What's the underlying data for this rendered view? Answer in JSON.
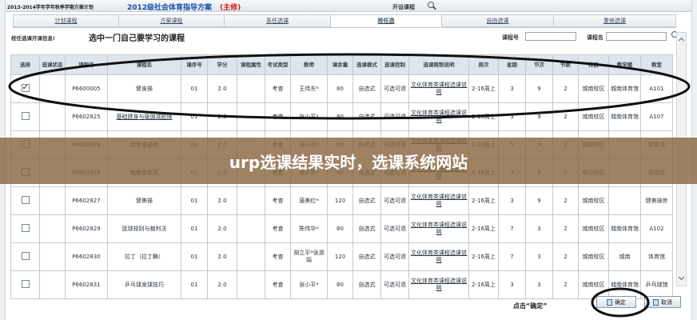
{
  "header": {
    "term": "2013-2014学年学年秋季学期方案计划",
    "plan": "2012级社会体育指导方案",
    "major": "(主修)",
    "section_title": "开设课程"
  },
  "tabs": [
    {
      "label": "计划课程"
    },
    {
      "label": "方案课程"
    },
    {
      "label": "系任选课"
    },
    {
      "label": "校任选"
    },
    {
      "label": "自由选课"
    },
    {
      "label": "重修选课"
    }
  ],
  "filter": {
    "notice": "校任选课开课信息!",
    "instruction": "选中一门自己要学习的课程",
    "code_label": "课程号",
    "code_value": "",
    "name_label": "课程名",
    "name_value": ""
  },
  "icons": {
    "top_search": "search-icon",
    "filter_search": "search-icon",
    "clear": "close-icon",
    "scroll_up": "chevron-up-icon",
    "scroll_down": "chevron-down-icon",
    "close_glyph": "×"
  },
  "table": {
    "columns": [
      "选择",
      "选课状态",
      "课程号",
      "课程名",
      "课序号",
      "学分",
      "课程属性",
      "考试类型",
      "教师",
      "课余量",
      "选课模式",
      "选课控制",
      "选课限制说明",
      "周次",
      "星期",
      "节次",
      "节数",
      "校区",
      "教学楼",
      "教室"
    ],
    "rows": [
      {
        "checked": true,
        "name_is_link": false,
        "cells": [
          "",
          "P6600005",
          "健身操",
          "01",
          "2.0",
          "",
          "考查",
          "王伟东*",
          "80",
          "自选式",
          "可选可退",
          "文化体育类课程选课说明",
          "2-16周上",
          "3",
          "9",
          "2",
          "城南校区",
          "城南体育馆",
          "A101"
        ]
      },
      {
        "checked": false,
        "name_is_link": true,
        "cells": [
          "",
          "P6602825",
          "基础健身与瑜伽减肥操",
          "01",
          "2.0",
          "",
          "考查",
          "张小平*",
          "80",
          "自选式",
          "可选可退",
          "文化体育类课程选课说明",
          "2-16周上",
          "3",
          "9",
          "2",
          "城南校区",
          "城南体育馆",
          "A107"
        ]
      },
      {
        "checked": false,
        "name_is_link": false,
        "cells": [
          "",
          "P6602826",
          "跆拳道基础",
          "01",
          "2.0",
          "",
          "考查",
          "张小平*",
          "80",
          "自选式",
          "可选可退",
          "文化体育类课程选课说明",
          "2-16周上",
          "5",
          "9",
          "2",
          "城南校区",
          "",
          "体育场"
        ]
      },
      {
        "checked": false,
        "name_is_link": false,
        "cells": [
          "",
          "P6602828",
          "跆拳道提高",
          "01",
          "2.0",
          "",
          "考查",
          "张小平*",
          "80",
          "自选式",
          "可选可退",
          "文化体育类课程选课说明",
          "2-16周上",
          "3",
          "9",
          "2",
          "中心校区",
          "",
          "运动场"
        ]
      },
      {
        "checked": false,
        "name_is_link": false,
        "cells": [
          "",
          "P6602827",
          "健美操",
          "01",
          "2.0",
          "",
          "考查",
          "唐美红*",
          "120",
          "自选式",
          "可选可退",
          "文化体育类课程选课说明",
          "2-16周上",
          "3",
          "9",
          "2",
          "城南校区",
          "",
          "健美操房"
        ]
      },
      {
        "checked": false,
        "name_is_link": false,
        "cells": [
          "",
          "P6602829",
          "篮球规则与裁判法",
          "01",
          "2.0",
          "",
          "考查",
          "陈伟华*",
          "80",
          "自选式",
          "可选可退",
          "文化体育类课程选课说明",
          "2-16周上",
          "7",
          "3",
          "2",
          "城南校区",
          "城南体育馆",
          "A102"
        ]
      },
      {
        "checked": false,
        "name_is_link": false,
        "cells": [
          "",
          "P6602830",
          "拉丁（拉丁舞）",
          "01",
          "2.0",
          "",
          "考查",
          "胡立平*张淑娟",
          "120",
          "自选式",
          "可选可退",
          "文化体育类课程选课说明",
          "2-16周上",
          "7",
          "3",
          "2",
          "城南校区",
          "城南",
          "体育馆"
        ]
      },
      {
        "checked": false,
        "name_is_link": false,
        "cells": [
          "",
          "P6602831",
          "乒乓球发球技巧",
          "01",
          "2.0",
          "",
          "考查",
          "张小平*",
          "80",
          "自选式",
          "可选可退",
          "文化体育类课程选课说明",
          "2-16周上",
          "3",
          "3",
          "2",
          "城南校区",
          "城南体育馆",
          "乒乓球馆"
        ]
      }
    ]
  },
  "footer": {
    "hint": "点击“确定”",
    "confirm_label": "确定",
    "cancel_label": "取消"
  },
  "banner": {
    "text": "urp选课结果实时，选课系统网站"
  },
  "colors": {
    "plan_text": "#1a4fa0",
    "major_text": "#cc2222",
    "header_bg": "#dfe5ec",
    "banner_bg": "#8a6642",
    "annotation_stroke": "#111111"
  }
}
